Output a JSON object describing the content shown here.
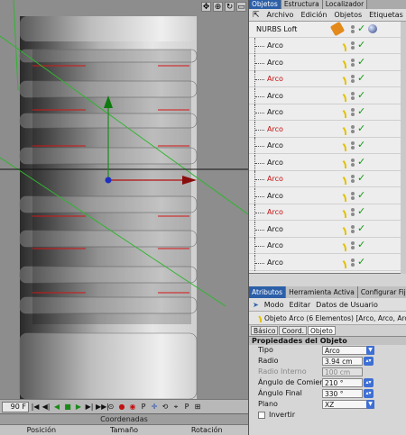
{
  "viewport": {
    "nav_icons": [
      "move-icon",
      "zoom-icon",
      "rotate-icon",
      "maximize-icon"
    ],
    "nav_glyphs": [
      "✥",
      "⊕",
      "↻",
      "▭"
    ]
  },
  "timeline": {
    "frame": "90 F",
    "buttons": [
      "|◀",
      "◀|",
      "◀",
      "■",
      "▶",
      "▶|",
      "▶▶|",
      "⊙",
      "●",
      "◉",
      "P",
      "✛",
      "⟲",
      "⌖",
      "P",
      "⊞"
    ]
  },
  "coordinates": {
    "title": "Coordenadas",
    "columns": [
      "Posición",
      "Tamaño",
      "Rotación"
    ]
  },
  "objects_panel": {
    "tabs": [
      "Objetos",
      "Estructura",
      "Localizador"
    ],
    "menu": [
      "Archivo",
      "Edición",
      "Objetos",
      "Etiquetas",
      "T"
    ],
    "root": "NURBS Loft",
    "children": [
      {
        "name": "Arco",
        "red": false
      },
      {
        "name": "Arco",
        "red": false
      },
      {
        "name": "Arco",
        "red": true
      },
      {
        "name": "Arco",
        "red": false
      },
      {
        "name": "Arco",
        "red": false
      },
      {
        "name": "Arco",
        "red": true
      },
      {
        "name": "Arco",
        "red": false
      },
      {
        "name": "Arco",
        "red": false
      },
      {
        "name": "Arco",
        "red": true
      },
      {
        "name": "Arco",
        "red": false
      },
      {
        "name": "Arco",
        "red": true
      },
      {
        "name": "Arco",
        "red": false
      },
      {
        "name": "Arco",
        "red": false
      },
      {
        "name": "Arco",
        "red": false
      }
    ]
  },
  "attributes": {
    "tabs": [
      "Atributos",
      "Herramienta Activa",
      "Configurar Fija"
    ],
    "menu": [
      "Modo",
      "Editar",
      "Datos de Usuario"
    ],
    "object_line": "Objeto Arco (6 Elementos) [Arco, Arco, Arc",
    "subtabs": [
      "Básico",
      "Coord.",
      "Objeto"
    ],
    "section": "Propiedades del Objeto",
    "props": {
      "tipo": {
        "label": "Tipo",
        "value": "Arco"
      },
      "radio": {
        "label": "Radio",
        "value": "3.94 cm"
      },
      "radio_interno": {
        "label": "Radio Interno",
        "value": "100 cm"
      },
      "angulo_comienzo": {
        "label": "Ángulo de Comienzo",
        "value": "210 °"
      },
      "angulo_final": {
        "label": "Ángulo Final",
        "value": "330 °"
      },
      "plano": {
        "label": "Plano",
        "value": "XZ"
      },
      "invertir": {
        "label": "Invertir"
      }
    }
  },
  "colors": {
    "active_tab": "#2c5fa8",
    "check": "#119911",
    "red_name": "#c41010",
    "spline": "#e2c200"
  }
}
